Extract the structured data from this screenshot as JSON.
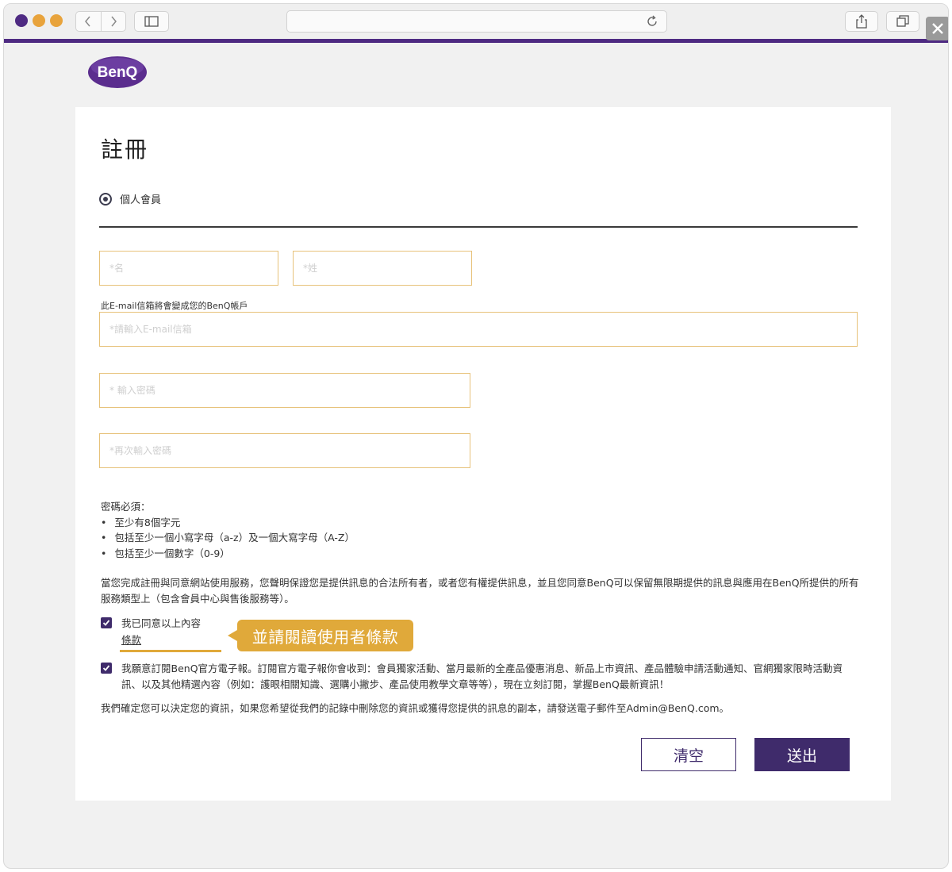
{
  "browser": {
    "address": "",
    "accent_color": "#4e2a82"
  },
  "logo": {
    "text": "BenQ",
    "color": "#5b2d8e"
  },
  "form": {
    "title": "註冊",
    "member_type": "個人會員",
    "first_name_placeholder": "*名",
    "last_name_placeholder": "*姓",
    "email_note": "此E-mail信箱將會變成您的BenQ帳戶",
    "email_placeholder": "*請輸入E-mail信箱",
    "password_placeholder": "* 輸入密碼",
    "password_confirm_placeholder": "*再次輸入密碼",
    "password_rules_title": "密碼必須：",
    "password_rules": [
      "至少有8個字元",
      "包括至少一個小寫字母（a-z）及一個大寫字母（A-Z）",
      "包括至少一個數字（0-9）"
    ],
    "legal_text": "當您完成註冊與同意網站使用服務，您聲明保證您是提供訊息的合法所有者，或者您有權提供訊息，並且您同意BenQ可以保留無限期提供的訊息與應用在BenQ所提供的所有服務類型上（包含會員中心與售後服務等）。",
    "agree_label": "我已同意以上內容",
    "terms_link": "條款",
    "callout": "並請閱讀使用者條款",
    "newsletter_label": "我願意訂閱BenQ官方電子報。訂閱官方電子報你會收到：會員獨家活動、當月最新的全產品優惠消息、新品上市資訊、產品體驗申請活動通知、官網獨家限時活動資訊、以及其他精選內容（例如：護眼相關知識、選購小撇步、產品使用教學文章等等），現在立刻訂閱，掌握BenQ最新資訊！",
    "contact_text": "我們確定您可以決定您的資訊，如果您希望從我們的記錄中刪除您的資訊或獲得您提供的訊息的副本，請發送電子郵件至Admin@BenQ.com。",
    "clear_button": "清空",
    "submit_button": "送出"
  },
  "colors": {
    "brand_purple": "#3f2b6b",
    "highlight_gold": "#e0a93a",
    "field_border": "#e7c27a"
  }
}
